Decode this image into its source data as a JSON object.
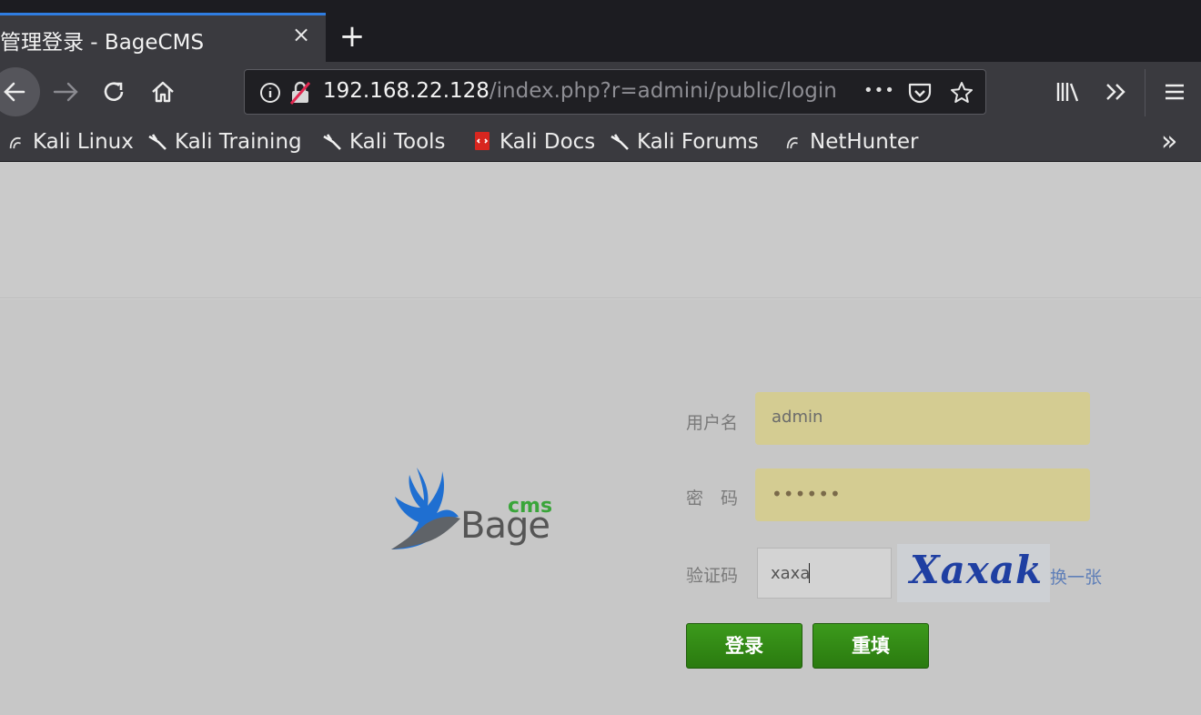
{
  "browser": {
    "tab_title": "管理登录 - BageCMS",
    "tab_close": "×",
    "new_tab": "+",
    "url_host": "192.168.22.128",
    "url_path": "/index.php?r=admini/public/login",
    "url_more": "•••",
    "bookmarks": [
      {
        "label": "Kali Linux",
        "icon": "kali-dragon-icon"
      },
      {
        "label": "Kali Training",
        "icon": "kali-dragon-icon"
      },
      {
        "label": "Kali Tools",
        "icon": "kali-dragon-icon"
      },
      {
        "label": "Kali Docs",
        "icon": "docs-icon"
      },
      {
        "label": "Kali Forums",
        "icon": "kali-dragon-icon"
      },
      {
        "label": "NetHunter",
        "icon": "kali-dragon-icon"
      }
    ],
    "bookmarks_overflow": "»"
  },
  "login": {
    "logo_cms": "cms",
    "logo_bage": "Bage",
    "username_label": "用户名",
    "username_value": "admin",
    "password_label": "密　码",
    "password_value": "••••••",
    "captcha_label": "验证码",
    "captcha_value": "xaxa",
    "captcha_image_text": "Xaxak",
    "refresh_link": "换一张",
    "submit_label": "登录",
    "reset_label": "重填"
  },
  "colors": {
    "accent_tab": "#2f7de1",
    "button_green": "#2f8a14",
    "field_fill": "#d4cc92"
  }
}
